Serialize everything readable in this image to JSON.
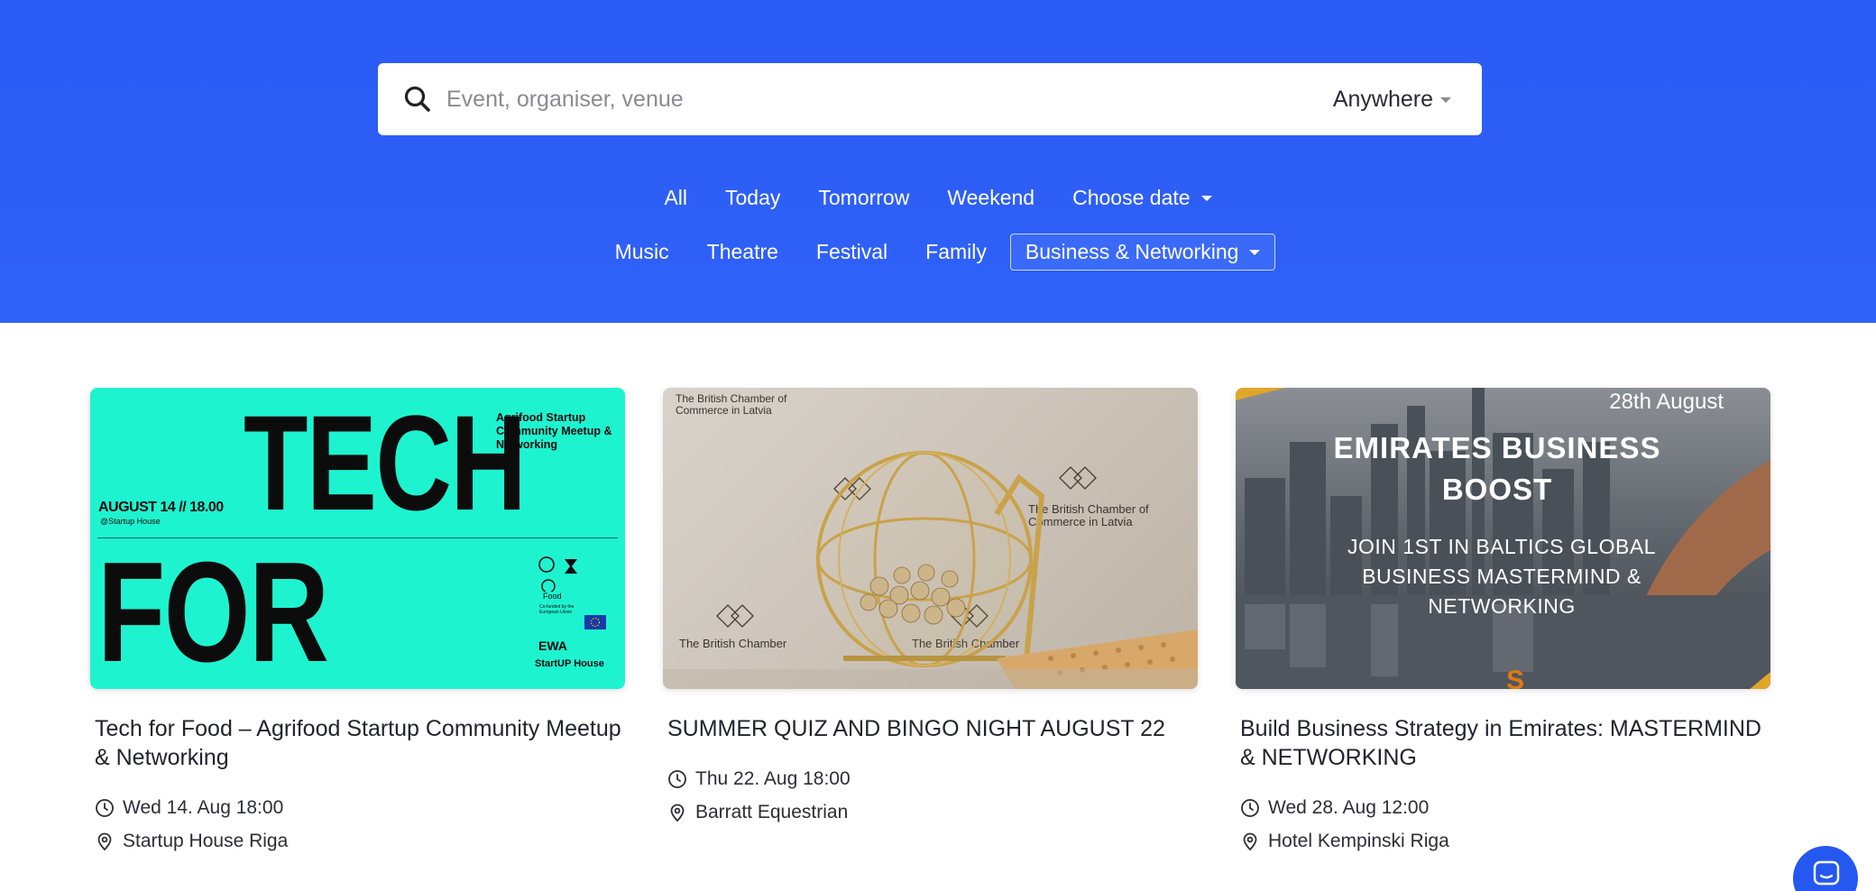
{
  "search": {
    "placeholder": "Event, organiser, venue",
    "location_label": "Anywhere"
  },
  "filters": {
    "dates": [
      {
        "label": "All"
      },
      {
        "label": "Today"
      },
      {
        "label": "Tomorrow"
      },
      {
        "label": "Weekend"
      },
      {
        "label": "Choose date"
      }
    ],
    "categories": [
      {
        "label": "Music"
      },
      {
        "label": "Theatre"
      },
      {
        "label": "Festival"
      },
      {
        "label": "Family"
      },
      {
        "label": "Business & Networking",
        "active": true
      }
    ]
  },
  "events": [
    {
      "title": "Tech for Food – Agrifood Startup Community Meetup & Networking",
      "datetime": "Wed 14. Aug 18:00",
      "venue": "Startup House Riga",
      "image": {
        "headline_1": "TECH",
        "headline_2": "FOR FOOD",
        "subtitle": "Agrifood Startup Community Meetup & Networking",
        "date_text": "AUGUST 14 // 18.00",
        "place_text": "@Startup House",
        "logo_1": "Food",
        "logo_2": "Co-funded by the European Union",
        "logo_3": "EWA",
        "logo_4": "StartUP House"
      }
    },
    {
      "title": "SUMMER QUIZ AND BINGO NIGHT AUGUST 22",
      "datetime": "Thu 22. Aug 18:00",
      "venue": "Barratt Equestrian",
      "image": {
        "banner_1": "The British Chamber of Commerce in Latvia",
        "banner_2": "The British Chamber of Commerce in Latvia",
        "banner_3": "The British Chamber",
        "banner_4": "The British Chamber"
      }
    },
    {
      "title": "Build Business Strategy in Emirates: MASTERMIND & NETWORKING",
      "datetime": "Wed 28. Aug 12:00",
      "venue": "Hotel Kempinski Riga",
      "image": {
        "date_text": "28th August",
        "headline": "EMIRATES BUSINESS BOOST",
        "tagline": "JOIN 1ST IN BALTICS GLOBAL BUSINESS MASTERMIND & NETWORKING"
      }
    }
  ],
  "colors": {
    "hero_blue": "#2d5ff7",
    "card1_bg": "#1ef3d0",
    "chat_button": "#2558f0"
  },
  "icons": {
    "search": "search-icon",
    "clock": "clock-icon",
    "location": "map-pin-icon",
    "chat": "chat-icon"
  }
}
